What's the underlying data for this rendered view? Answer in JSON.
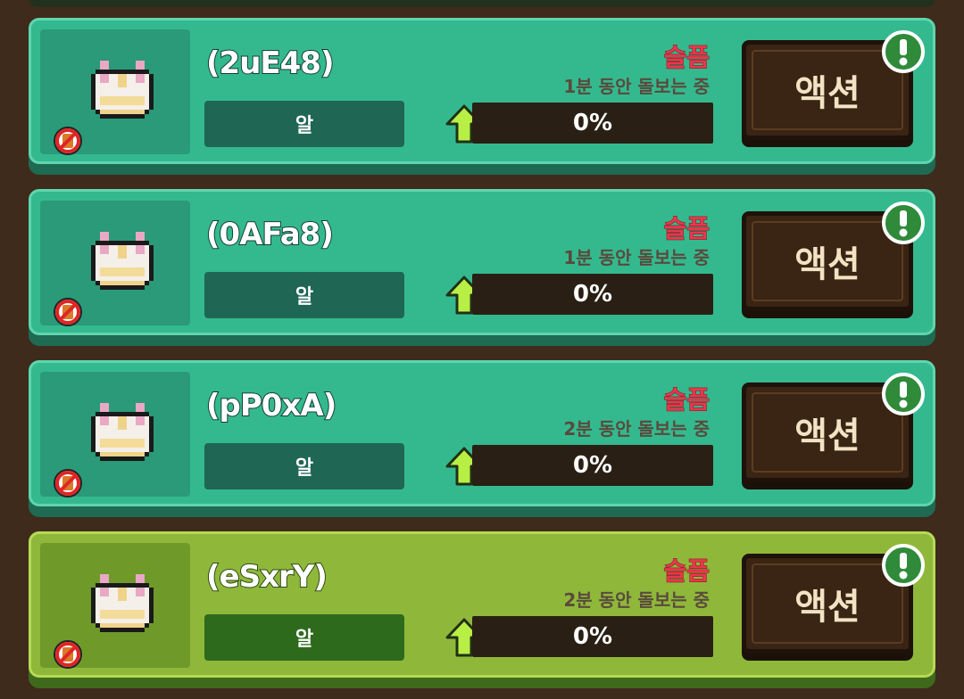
{
  "pets": [
    {
      "name": "(2uE48)",
      "type": "알",
      "mood": "슬픔",
      "status": "1분 동안 돌보는 중",
      "progress_percent": 0,
      "progress_label": "0%",
      "action_label": "액션",
      "theme": "teal"
    },
    {
      "name": "(0AFa8)",
      "type": "알",
      "mood": "슬픔",
      "status": "1분 동안 돌보는 중",
      "progress_percent": 0,
      "progress_label": "0%",
      "action_label": "액션",
      "theme": "teal"
    },
    {
      "name": "(pP0xA)",
      "type": "알",
      "mood": "슬픔",
      "status": "2분 동안 돌보는 중",
      "progress_percent": 0,
      "progress_label": "0%",
      "action_label": "액션",
      "theme": "teal"
    },
    {
      "name": "(eSxrY)",
      "type": "알",
      "mood": "슬픔",
      "status": "2분 동안 돌보는 중",
      "progress_percent": 0,
      "progress_label": "0%",
      "action_label": "액션",
      "theme": "lime"
    }
  ],
  "icons": {
    "pet": "pet-sprite-icon",
    "forbid": "no-action-icon",
    "arrow": "arrow-up-icon",
    "alert": "exclamation-alert-icon"
  },
  "colors": {
    "teal_card": "#34b98f",
    "lime_card": "#8fb83a",
    "mood_red": "#e8384a",
    "alert_green": "#2f8a3a"
  }
}
